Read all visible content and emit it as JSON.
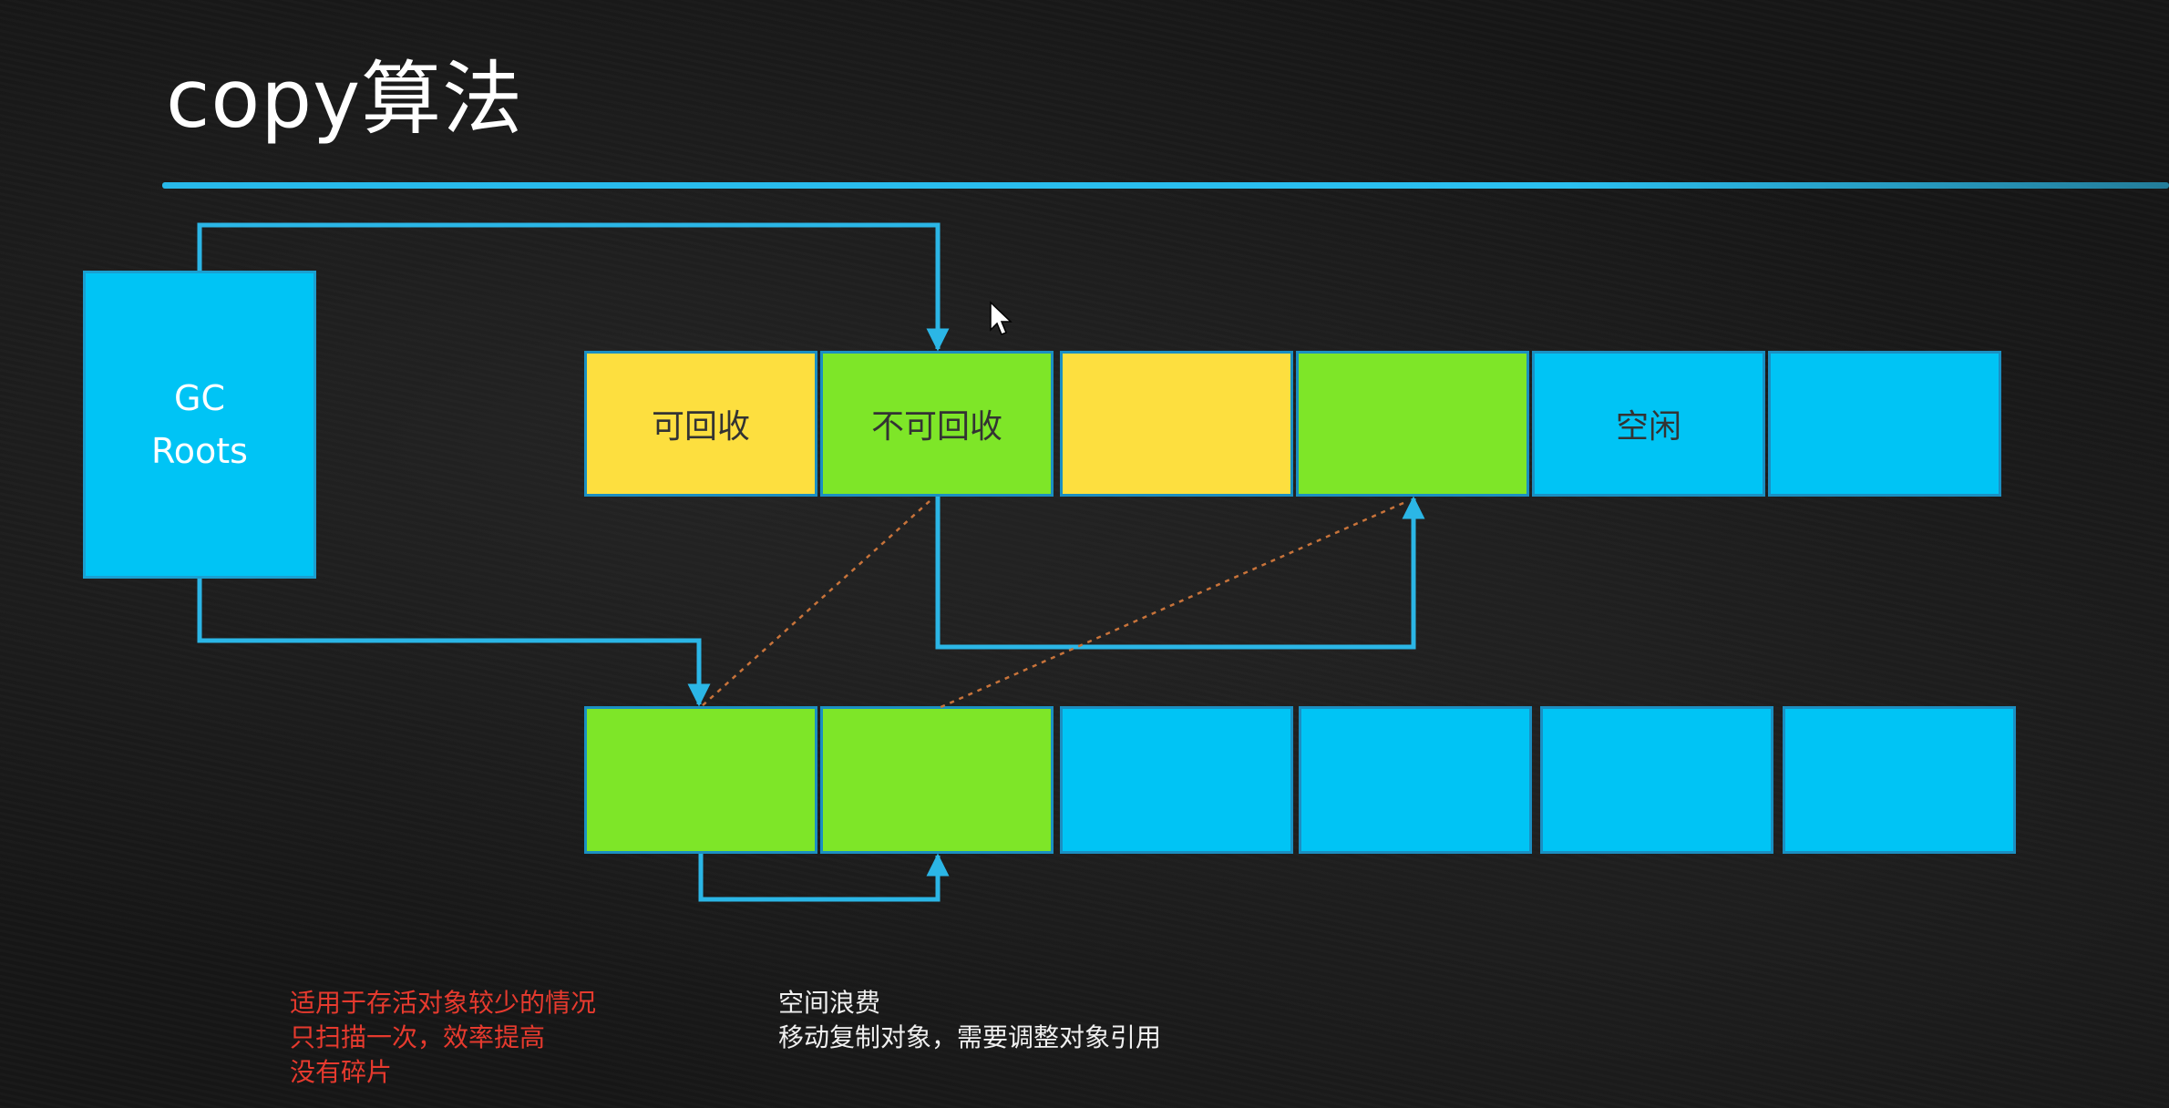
{
  "title": "copy算法",
  "gc_roots": {
    "label": "GC\nRoots"
  },
  "top_row": [
    {
      "label": "可回收",
      "state": "yellow"
    },
    {
      "label": "不可回收",
      "state": "green"
    },
    {
      "label": "",
      "state": "yellow"
    },
    {
      "label": "",
      "state": "green"
    },
    {
      "label": "空闲",
      "state": "blue"
    },
    {
      "label": "",
      "state": "blue"
    }
  ],
  "bottom_row": [
    {
      "label": "",
      "state": "green"
    },
    {
      "label": "",
      "state": "green"
    },
    {
      "label": "",
      "state": "blue"
    },
    {
      "label": "",
      "state": "blue"
    },
    {
      "label": "",
      "state": "blue"
    },
    {
      "label": "",
      "state": "blue"
    }
  ],
  "advantages": [
    "适用于存活对象较少的情况",
    "只扫描一次，效率提高",
    "没有碎片"
  ],
  "disadvantages": [
    "空间浪费",
    "移动复制对象，需要调整对象引用"
  ],
  "colors": {
    "yellow": "#fddf3f",
    "green": "#7ee628",
    "blue": "#00c4f5",
    "arrow": "#2bb6e6",
    "dotted": "#c8733a",
    "advantages_text": "#e63a2e"
  }
}
